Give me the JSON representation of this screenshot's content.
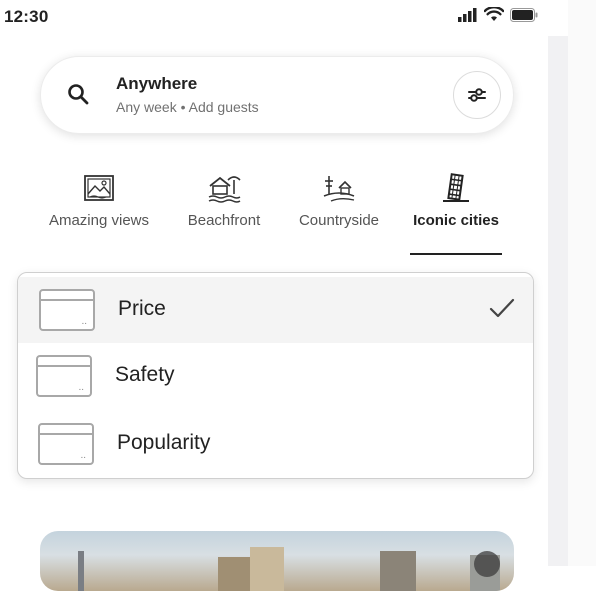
{
  "status_bar": {
    "time": "12:30",
    "icons": [
      "signal-icon",
      "wifi-icon",
      "battery-icon"
    ]
  },
  "search": {
    "title": "Anywhere",
    "subtitle": "Any week  • Add guests",
    "icons": [
      "search-icon",
      "filter-icon"
    ]
  },
  "categories": [
    {
      "label": "Amazing views",
      "icon": "picture-frame-icon",
      "active": false
    },
    {
      "label": "Beachfront",
      "icon": "beach-hut-icon",
      "active": false
    },
    {
      "label": "Countryside",
      "icon": "countryside-icon",
      "active": false
    },
    {
      "label": "Iconic cities",
      "icon": "leaning-tower-icon",
      "active": true
    }
  ],
  "sort_menu": {
    "options": [
      {
        "label": "Price",
        "selected": true
      },
      {
        "label": "Safety",
        "selected": false
      },
      {
        "label": "Popularity",
        "selected": false
      }
    ],
    "selected_icon": "checkmark-icon"
  },
  "listing": {
    "icons": [
      "heart-icon"
    ]
  },
  "colors": {
    "text_primary": "#222222",
    "text_secondary": "#717171",
    "selected_row": "#f4f4f4",
    "border": "#cfcfcf"
  }
}
